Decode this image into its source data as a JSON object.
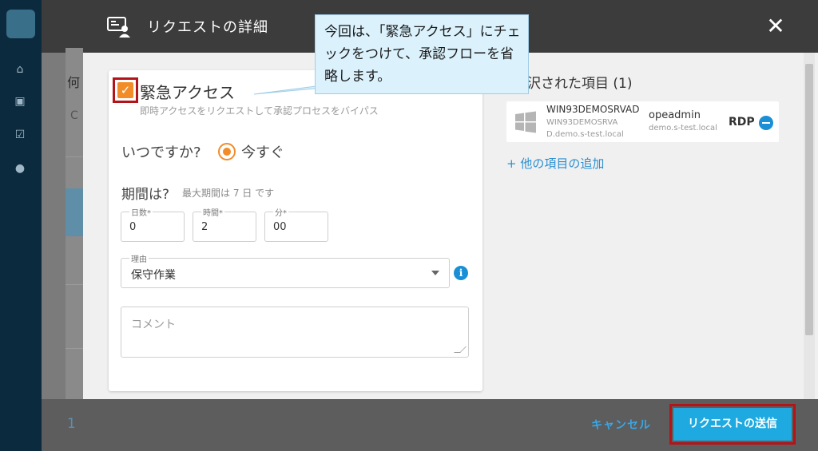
{
  "background": {
    "fragment_he": "何",
    "fragment_c": "C",
    "footer_number": "1"
  },
  "modal": {
    "title": "リクエストの詳細",
    "close_symbol": "✕"
  },
  "callout": {
    "text": "今回は、「緊急アクセス」にチェックをつけて、承認フローを省略します。"
  },
  "form": {
    "urgent_access_label": "緊急アクセス",
    "urgent_access_description": "即時アクセスをリクエストして承認プロセスをバイパス",
    "urgent_access_checked": true,
    "when_label": "いつですか?",
    "when_option": "今すぐ",
    "period_label": "期間は?",
    "period_max": "最大期間は 7 日 です",
    "days_label": "日数",
    "days_value": "0",
    "hours_label": "時間",
    "hours_value": "2",
    "minutes_label": "分",
    "minutes_value": "00",
    "required_mark": "*",
    "reason_label": "理由",
    "reason_value": "保守作業",
    "comment_placeholder": "コメント"
  },
  "selected": {
    "title": "沢された項目 (1)",
    "items": [
      {
        "host": "WIN93DEMOSRVAD",
        "fqdn": "WIN93DEMOSRVAD.demo.s-test.local",
        "user": "opeadmin",
        "domain": "demo.s-test.local",
        "protocol": "RDP"
      }
    ],
    "add_more_label": "+ 他の項目の追加"
  },
  "footer": {
    "cancel_label": "キャンセル",
    "send_label": "リクエストの送信"
  },
  "colors": {
    "accent_orange": "#f28c28",
    "primary_blue": "#1eaae0",
    "highlight_red": "#b3141a",
    "header_dark": "#3c3c3c"
  },
  "icons": {
    "header": "request-detail-icon",
    "os": "windows-icon",
    "remove": "minus-circle-icon",
    "info": "info-icon"
  }
}
